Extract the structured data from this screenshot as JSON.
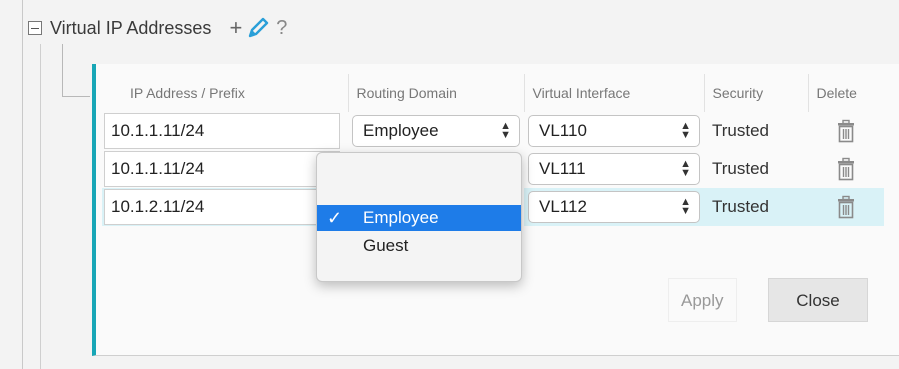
{
  "section": {
    "title": "Virtual IP Addresses",
    "add_symbol": "+",
    "help_symbol": "?"
  },
  "table": {
    "headers": [
      "IP Address / Prefix",
      "Routing Domain",
      "Virtual Interface",
      "Security",
      "Delete"
    ],
    "rows": [
      {
        "ip": "10.1.1.11/24",
        "routing_domain": "Employee",
        "virtual_interface": "VL110",
        "security": "Trusted"
      },
      {
        "ip": "10.1.1.11/24",
        "routing_domain": "",
        "virtual_interface": "VL111",
        "security": "Trusted"
      },
      {
        "ip": "10.1.2.11/24",
        "routing_domain": "",
        "virtual_interface": "VL112",
        "security": "Trusted"
      }
    ],
    "selected_row_index": 2
  },
  "dropdown": {
    "options": [
      "Employee",
      "Guest"
    ],
    "selected": "Employee",
    "check_mark": "✓"
  },
  "buttons": {
    "apply": "Apply",
    "close": "Close"
  },
  "colors": {
    "accent": "#17a6b6",
    "selected_row": "#d9f2f7",
    "dropdown_highlight": "#1e7ce8",
    "pencil": "#2a9fd8"
  },
  "icons": {
    "collapse": "minus-box-icon",
    "add": "plus-icon",
    "edit": "pencil-icon",
    "help": "question-icon",
    "delete": "trash-icon",
    "select": "updown-arrows-icon"
  }
}
